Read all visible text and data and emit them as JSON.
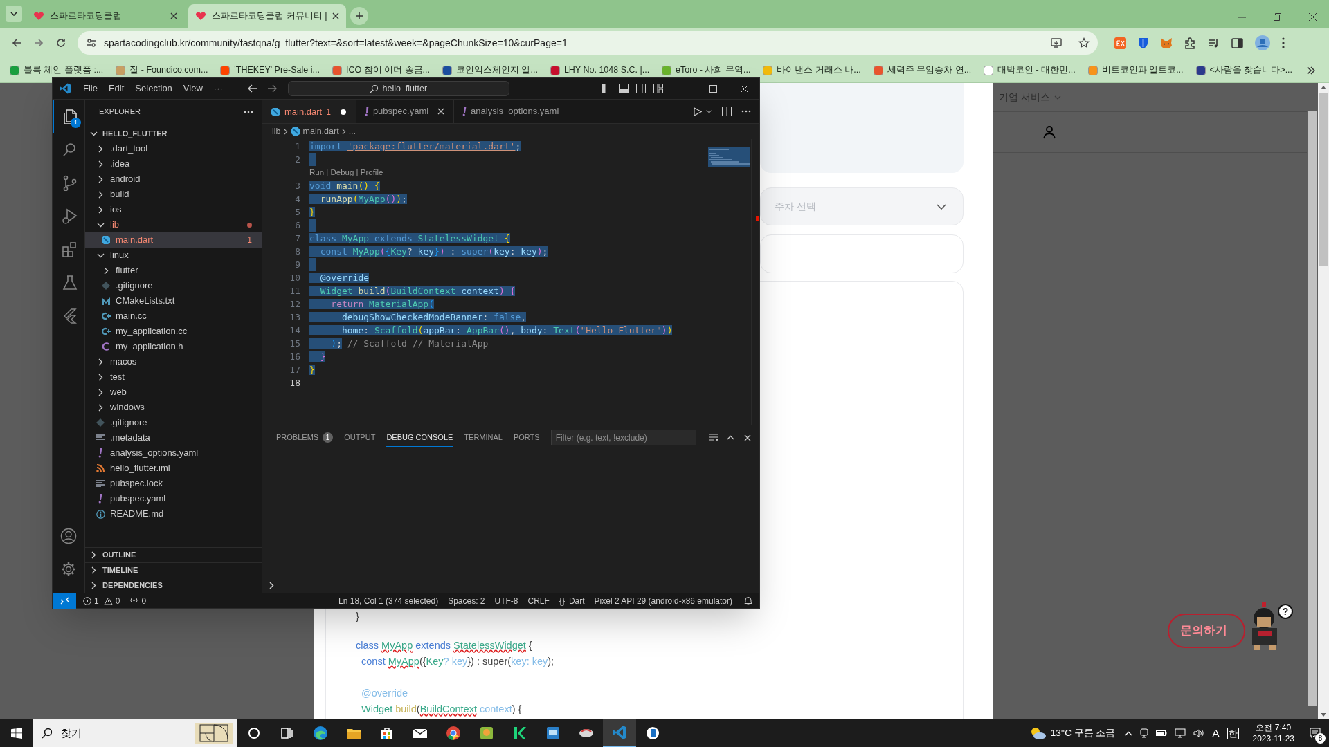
{
  "browser": {
    "tabs": [
      {
        "title": "스파르타코딩클럽",
        "selected": false
      },
      {
        "title": "스파르타코딩클럽 커뮤니티 |",
        "selected": true
      }
    ],
    "url": "spartacodingclub.kr/community/fastqna/g_flutter?text=&sort=latest&week=&pageChunkSize=10&curPage=1",
    "bookmarks": [
      {
        "title": "블록 체인 플랫폼 :...",
        "color": "#1a9e3f"
      },
      {
        "title": "잘 - Foundico.com...",
        "color": "#c9a064"
      },
      {
        "title": "'THEKEY' Pre-Sale i...",
        "color": "#ff4500"
      },
      {
        "title": "ICO 참여 이더 송금...",
        "color": "#e8542e"
      },
      {
        "title": "코인익스체인지 알...",
        "color": "#1c4fa0"
      },
      {
        "title": "LHY No. 1048 S.C. |...",
        "color": "#c8102e"
      },
      {
        "title": "eToro - 사회 무역...",
        "color": "#6ab42d"
      },
      {
        "title": "바이낸스 거래소 나...",
        "color": "#f0b90b"
      },
      {
        "title": "세력주 무임승차 연...",
        "color": "#e8542e"
      },
      {
        "title": "대박코인 - 대한민...",
        "color": "#ffffff"
      },
      {
        "title": "비트코인과 알트코...",
        "color": "#f7931a"
      },
      {
        "title": "<사람을 찾습니다>...",
        "color": "#2b3a8c"
      }
    ]
  },
  "page": {
    "week_select": {
      "placeholder": "주차 선택"
    },
    "menu": "기업 서비스",
    "code_lines": [
      {
        "kind": "code",
        "tokens": [
          {
            "text": "}",
            "kind": "plain"
          }
        ]
      },
      {
        "kind": "blank"
      },
      {
        "kind": "code",
        "tokens": [
          {
            "text": "class ",
            "kind": "kw"
          },
          {
            "text": "MyApp",
            "kind": "type_err"
          },
          {
            "text": " extends ",
            "kind": "kw"
          },
          {
            "text": "StatelessWidget",
            "kind": "type_err"
          },
          {
            "text": " {",
            "kind": "plain"
          }
        ]
      },
      {
        "kind": "code",
        "tokens": [
          {
            "text": "  const ",
            "kind": "kw"
          },
          {
            "text": "MyApp",
            "kind": "type_err"
          },
          {
            "text": "({",
            "kind": "plain"
          },
          {
            "text": "Key",
            "kind": "type"
          },
          {
            "text": "? key",
            "kind": "var"
          },
          {
            "text": "}) : super(",
            "kind": "plain"
          },
          {
            "text": "key: key",
            "kind": "var"
          },
          {
            "text": ");",
            "kind": "plain"
          }
        ]
      },
      {
        "kind": "blank"
      },
      {
        "kind": "code",
        "tokens": [
          {
            "text": "  @override",
            "kind": "var"
          }
        ]
      },
      {
        "kind": "code",
        "tokens": [
          {
            "text": "  Widget ",
            "kind": "type"
          },
          {
            "text": "build",
            "kind": "fn"
          },
          {
            "text": "(",
            "kind": "plain"
          },
          {
            "text": "BuildContext",
            "kind": "type_err"
          },
          {
            "text": " context",
            "kind": "var"
          },
          {
            "text": ") {",
            "kind": "plain"
          }
        ]
      }
    ],
    "inquiry_button": "문의하기",
    "mascot_bubble": "?"
  },
  "vscode": {
    "menu": [
      "File",
      "Edit",
      "Selection",
      "View",
      "···"
    ],
    "command_center": "hello_flutter",
    "activity": [
      {
        "kind": "explorer",
        "selected": true,
        "badge": "1"
      },
      {
        "kind": "search",
        "selected": false
      },
      {
        "kind": "scm",
        "selected": false
      },
      {
        "kind": "debug",
        "selected": false
      },
      {
        "kind": "extensions",
        "selected": false
      },
      {
        "kind": "testing",
        "selected": false
      },
      {
        "kind": "flutter",
        "selected": false
      }
    ],
    "explorer": {
      "title": "EXPLORER",
      "root": {
        "label": "HELLO_FLUTTER",
        "expanded": true
      },
      "items": [
        {
          "label": ".dart_tool",
          "kind": "folder",
          "expanded": false,
          "selected": false,
          "error": false
        },
        {
          "label": ".idea",
          "kind": "folder",
          "expanded": false,
          "selected": false,
          "error": false
        },
        {
          "label": "android",
          "kind": "folder",
          "expanded": false,
          "selected": false,
          "error": false
        },
        {
          "label": "build",
          "kind": "folder",
          "expanded": false,
          "selected": false,
          "error": false
        },
        {
          "label": "ios",
          "kind": "folder",
          "expanded": false,
          "selected": false,
          "error": false
        },
        {
          "label": "lib",
          "kind": "folder",
          "expanded": true,
          "selected": false,
          "error": true,
          "problem_dot": true,
          "children": [
            {
              "label": "main.dart",
              "kind": "dart",
              "selected": true,
              "error": true,
              "problems": "1"
            }
          ]
        },
        {
          "label": "linux",
          "kind": "folder",
          "expanded": true,
          "selected": false,
          "error": false,
          "children": [
            {
              "label": "flutter",
              "kind": "folder",
              "expanded": false,
              "selected": false,
              "error": false
            },
            {
              "label": ".gitignore",
              "kind": "git",
              "selected": false,
              "error": false
            },
            {
              "label": "CMakeLists.txt",
              "kind": "cmake",
              "selected": false,
              "error": false
            },
            {
              "label": "main.cc",
              "kind": "cpp",
              "selected": false,
              "error": false
            },
            {
              "label": "my_application.cc",
              "kind": "cpp",
              "selected": false,
              "error": false
            },
            {
              "label": "my_application.h",
              "kind": "c",
              "selected": false,
              "error": false
            }
          ]
        },
        {
          "label": "macos",
          "kind": "folder",
          "expanded": false,
          "selected": false,
          "error": false
        },
        {
          "label": "test",
          "kind": "folder",
          "expanded": false,
          "selected": false,
          "error": false
        },
        {
          "label": "web",
          "kind": "folder",
          "expanded": false,
          "selected": false,
          "error": false
        },
        {
          "label": "windows",
          "kind": "folder",
          "expanded": false,
          "selected": false,
          "error": false
        },
        {
          "label": ".gitignore",
          "kind": "git",
          "selected": false,
          "error": false
        },
        {
          "label": ".metadata",
          "kind": "lines",
          "selected": false,
          "error": false
        },
        {
          "label": "analysis_options.yaml",
          "kind": "yaml",
          "selected": false,
          "error": false
        },
        {
          "label": "hello_flutter.iml",
          "kind": "rss",
          "selected": false,
          "error": false
        },
        {
          "label": "pubspec.lock",
          "kind": "lines",
          "selected": false,
          "error": false
        },
        {
          "label": "pubspec.yaml",
          "kind": "yaml",
          "selected": false,
          "error": false
        },
        {
          "label": "README.md",
          "kind": "info",
          "selected": false,
          "error": false
        }
      ],
      "sections": [
        {
          "label": "OUTLINE",
          "expanded": false
        },
        {
          "label": "TIMELINE",
          "expanded": false
        },
        {
          "label": "DEPENDENCIES",
          "expanded": false
        }
      ]
    },
    "tabs": [
      {
        "label": "main.dart",
        "kind": "dart",
        "problems": "1",
        "selected": true,
        "error": true,
        "modified": true,
        "close": false
      },
      {
        "label": "pubspec.yaml",
        "kind": "yaml",
        "selected": false,
        "error": false,
        "modified": false,
        "close": true
      },
      {
        "label": "analysis_options.yaml",
        "kind": "yaml",
        "selected": false,
        "error": false,
        "modified": false,
        "close": false
      }
    ],
    "breadcrumbs": [
      "lib",
      "main.dart",
      "..."
    ],
    "code_lens": "Run | Debug | Profile",
    "lines": [
      {
        "number": "1",
        "selected": true,
        "current": false,
        "tokens": [
          {
            "text": "import ",
            "kind": "kw"
          },
          {
            "text": "'package:flutter/material.dart'",
            "kind": "link"
          },
          {
            "text": ";",
            "kind": "plain"
          }
        ]
      },
      {
        "number": "2",
        "selected": true,
        "current": false,
        "lens": true
      },
      {
        "number": "3",
        "selected": true,
        "current": false,
        "tokens": [
          {
            "text": "void ",
            "kind": "kw"
          },
          {
            "text": "main",
            "kind": "fn"
          },
          {
            "text": "() {",
            "kind": "b1"
          }
        ]
      },
      {
        "number": "4",
        "selected": true,
        "current": false,
        "tokens": [
          {
            "text": "  runApp",
            "kind": "fn"
          },
          {
            "text": "(",
            "kind": "b1"
          },
          {
            "text": "MyApp",
            "kind": "type"
          },
          {
            "text": "()",
            "kind": "b2"
          },
          {
            "text": ")",
            "kind": "b1"
          },
          {
            "text": ";",
            "kind": "plain"
          }
        ]
      },
      {
        "number": "5",
        "selected": true,
        "current": false,
        "tokens": [
          {
            "text": "}",
            "kind": "b1"
          }
        ]
      },
      {
        "number": "6",
        "selected": true,
        "current": false
      },
      {
        "number": "7",
        "selected": true,
        "current": false,
        "tokens": [
          {
            "text": "class ",
            "kind": "kw"
          },
          {
            "text": "MyApp ",
            "kind": "type"
          },
          {
            "text": "extends ",
            "kind": "kw"
          },
          {
            "text": "StatelessWidget ",
            "kind": "type"
          },
          {
            "text": "{",
            "kind": "b1"
          }
        ]
      },
      {
        "number": "8",
        "selected": true,
        "current": false,
        "tokens": [
          {
            "text": "  const ",
            "kind": "kw"
          },
          {
            "text": "MyApp",
            "kind": "type"
          },
          {
            "text": "(",
            "kind": "b2"
          },
          {
            "text": "{",
            "kind": "b3"
          },
          {
            "text": "Key",
            "kind": "type"
          },
          {
            "text": "? ",
            "kind": "plain"
          },
          {
            "text": "key",
            "kind": "var"
          },
          {
            "text": "}",
            "kind": "b3"
          },
          {
            "text": ")",
            "kind": "b2"
          },
          {
            "text": " : ",
            "kind": "plain"
          },
          {
            "text": "super",
            "kind": "kw"
          },
          {
            "text": "(",
            "kind": "b2"
          },
          {
            "text": "key",
            "kind": "var"
          },
          {
            "text": ": ",
            "kind": "plain"
          },
          {
            "text": "key",
            "kind": "var"
          },
          {
            "text": ")",
            "kind": "b2"
          },
          {
            "text": ";",
            "kind": "plain"
          }
        ]
      },
      {
        "number": "9",
        "selected": true,
        "current": false
      },
      {
        "number": "10",
        "selected": true,
        "current": false,
        "tokens": [
          {
            "text": "  @override",
            "kind": "var"
          }
        ]
      },
      {
        "number": "11",
        "selected": true,
        "current": false,
        "tokens": [
          {
            "text": "  Widget ",
            "kind": "type"
          },
          {
            "text": "build",
            "kind": "fn"
          },
          {
            "text": "(",
            "kind": "b2"
          },
          {
            "text": "BuildContext ",
            "kind": "type"
          },
          {
            "text": "context",
            "kind": "var"
          },
          {
            "text": ") {",
            "kind": "b2"
          }
        ]
      },
      {
        "number": "12",
        "selected": true,
        "current": false,
        "tokens": [
          {
            "text": "    return ",
            "kind": "ctrl"
          },
          {
            "text": "MaterialApp",
            "kind": "type"
          },
          {
            "text": "(",
            "kind": "b3"
          }
        ]
      },
      {
        "number": "13",
        "selected": true,
        "current": false,
        "tokens": [
          {
            "text": "      debugShowCheckedModeBanner",
            "kind": "var"
          },
          {
            "text": ": ",
            "kind": "plain"
          },
          {
            "text": "false",
            "kind": "kw"
          },
          {
            "text": ",",
            "kind": "plain"
          }
        ]
      },
      {
        "number": "14",
        "selected": true,
        "current": false,
        "tokens": [
          {
            "text": "      home",
            "kind": "var"
          },
          {
            "text": ": ",
            "kind": "plain"
          },
          {
            "text": "Scaffold",
            "kind": "type"
          },
          {
            "text": "(",
            "kind": "b1"
          },
          {
            "text": "appBar",
            "kind": "var"
          },
          {
            "text": ": ",
            "kind": "plain"
          },
          {
            "text": "AppBar",
            "kind": "type"
          },
          {
            "text": "()",
            "kind": "b2"
          },
          {
            "text": ", ",
            "kind": "plain"
          },
          {
            "text": "body",
            "kind": "var"
          },
          {
            "text": ": ",
            "kind": "plain"
          },
          {
            "text": "Text",
            "kind": "type"
          },
          {
            "text": "(",
            "kind": "b2"
          },
          {
            "text": "\"Hello Flutter\"",
            "kind": "str"
          },
          {
            "text": ")",
            "kind": "b2"
          },
          {
            "text": ")",
            "kind": "b1"
          }
        ]
      },
      {
        "number": "15",
        "selected": true,
        "current": false,
        "tokens": [
          {
            "text": "    )",
            "kind": "b3"
          },
          {
            "text": ";",
            "kind": "plain"
          },
          {
            "text": " // Scaffold // MaterialApp",
            "kind": "hint"
          }
        ]
      },
      {
        "number": "16",
        "selected": true,
        "current": false,
        "tokens": [
          {
            "text": "  }",
            "kind": "b2"
          }
        ]
      },
      {
        "number": "17",
        "selected": true,
        "current": false,
        "tokens": [
          {
            "text": "}",
            "kind": "b1"
          }
        ]
      },
      {
        "number": "18",
        "selected": false,
        "current": true
      }
    ],
    "panel": {
      "tabs": [
        {
          "label": "PROBLEMS",
          "badge": "1",
          "selected": false
        },
        {
          "label": "OUTPUT",
          "selected": false
        },
        {
          "label": "DEBUG CONSOLE",
          "selected": true
        },
        {
          "label": "TERMINAL",
          "selected": false
        },
        {
          "label": "PORTS",
          "selected": false
        }
      ],
      "filter": {
        "placeholder": "Filter (e.g. text, !exclude)"
      }
    },
    "status": {
      "errors": "1",
      "warnings": "0",
      "ports": "0",
      "items": [
        "Ln 18, Col 1 (374 selected)",
        "Spaces: 2",
        "UTF-8",
        "CRLF"
      ],
      "language": {
        "icon": "{}",
        "text": "Dart"
      },
      "device": "Pixel 2 API 29 (android-x86 emulator)"
    }
  },
  "taskbar": {
    "search": "찾기",
    "apps": [
      {
        "kind": "cortana",
        "active": false
      },
      {
        "kind": "taskview",
        "active": false
      },
      {
        "kind": "edge",
        "active": false
      },
      {
        "kind": "files",
        "active": false
      },
      {
        "kind": "store",
        "active": false
      },
      {
        "kind": "mail",
        "active": false
      },
      {
        "kind": "chrome",
        "active": false
      },
      {
        "kind": "photo",
        "active": false
      },
      {
        "kind": "kotlin",
        "active": false
      },
      {
        "kind": "monitor",
        "active": false
      },
      {
        "kind": "cloud",
        "active": false
      },
      {
        "kind": "vscode",
        "active": true
      },
      {
        "kind": "phone",
        "active": false
      }
    ],
    "weather": "13°C 구름 조금",
    "input_mode": "A",
    "ime": "한",
    "time": "오전 7:40",
    "date": "2023-11-23",
    "notifications": "8"
  }
}
